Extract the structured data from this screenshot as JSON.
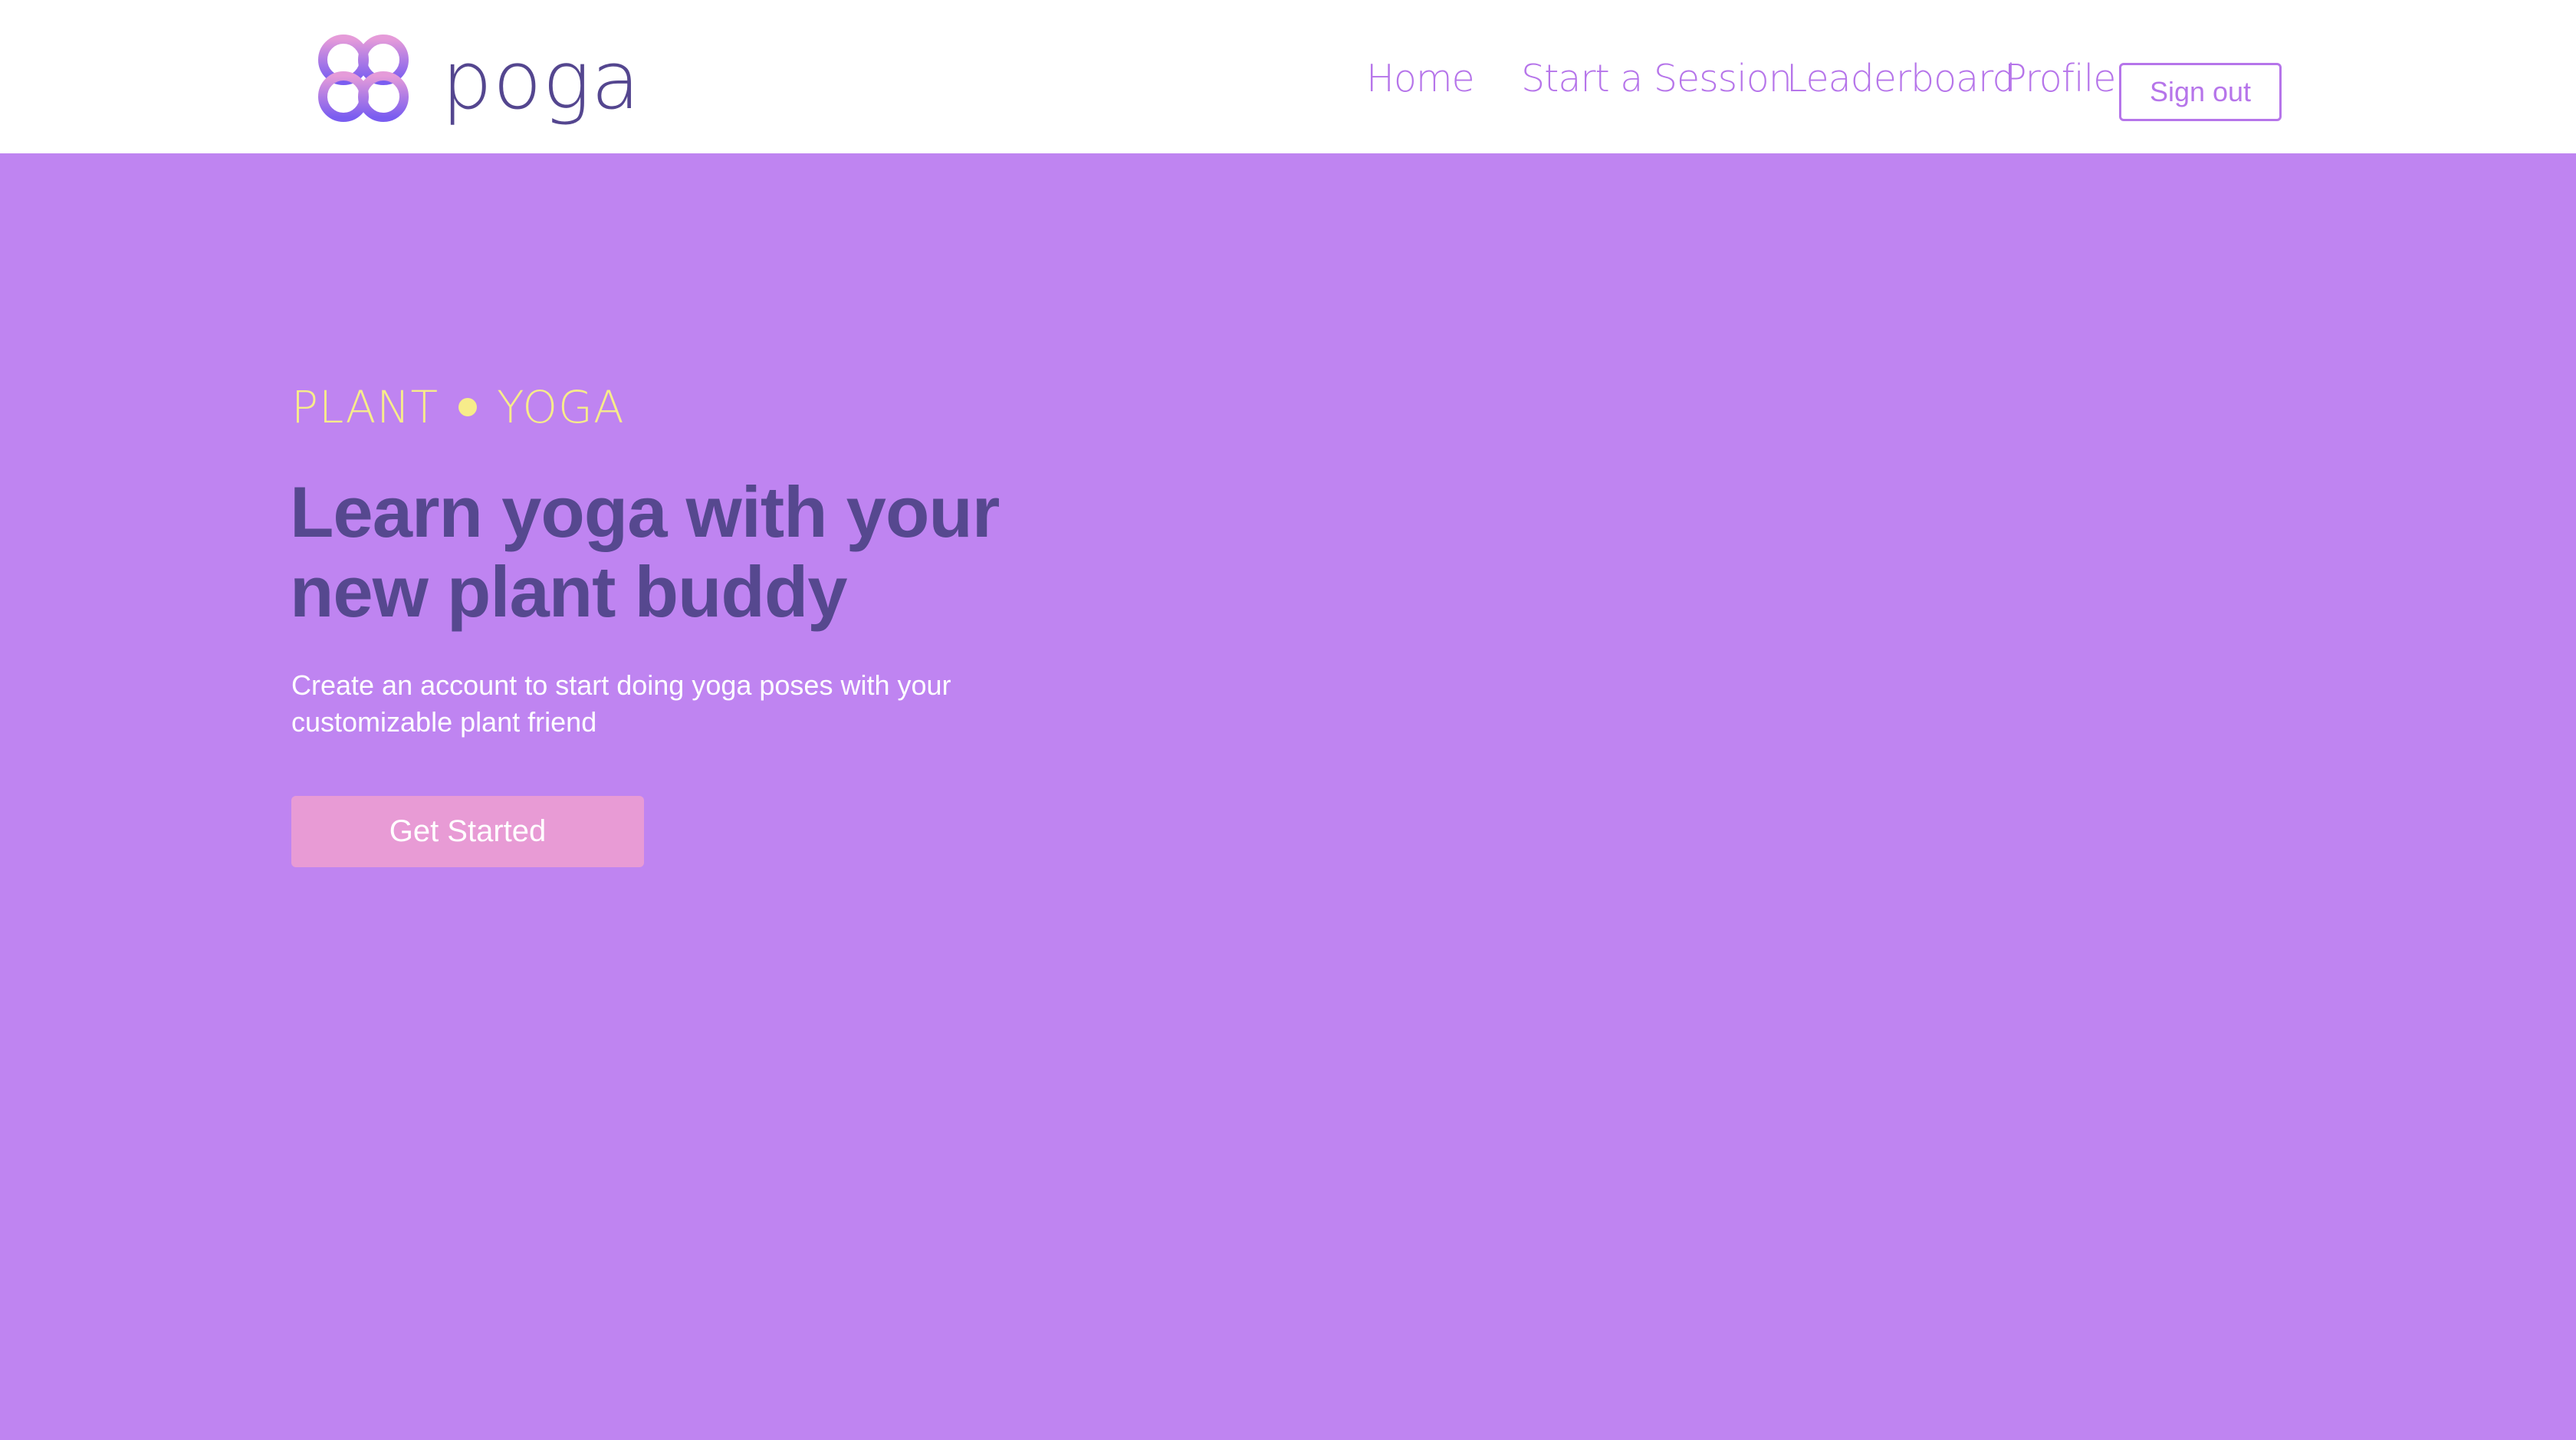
{
  "brand": {
    "name": "poga",
    "logo_icon": "triple-loop-logo-icon",
    "colors": {
      "page_background": "#bf84f1",
      "header_background": "#ffffff",
      "accent": "#b675ea",
      "logo_text": "#54468f",
      "logo_gradient_top": "#e59bd9",
      "logo_gradient_bottom": "#7a5df0",
      "eyebrow": "#f7ec8a",
      "heading": "#56488f",
      "body_text": "#ffffff",
      "cta_background": "#e89bd5"
    }
  },
  "nav": {
    "home": "Home",
    "start_session": "Start a Session",
    "leaderboard": "Leaderboard",
    "profile": "Profile",
    "sign_out": "Sign out"
  },
  "hero": {
    "eyebrow_left": "PLANT",
    "eyebrow_right": "YOGA",
    "title_line1": "Learn yoga with your",
    "title_line2": "new plant buddy",
    "subtitle_line1": "Create an account to start doing yoga poses with your",
    "subtitle_line2": "customizable plant friend",
    "cta_label": "Get Started"
  }
}
